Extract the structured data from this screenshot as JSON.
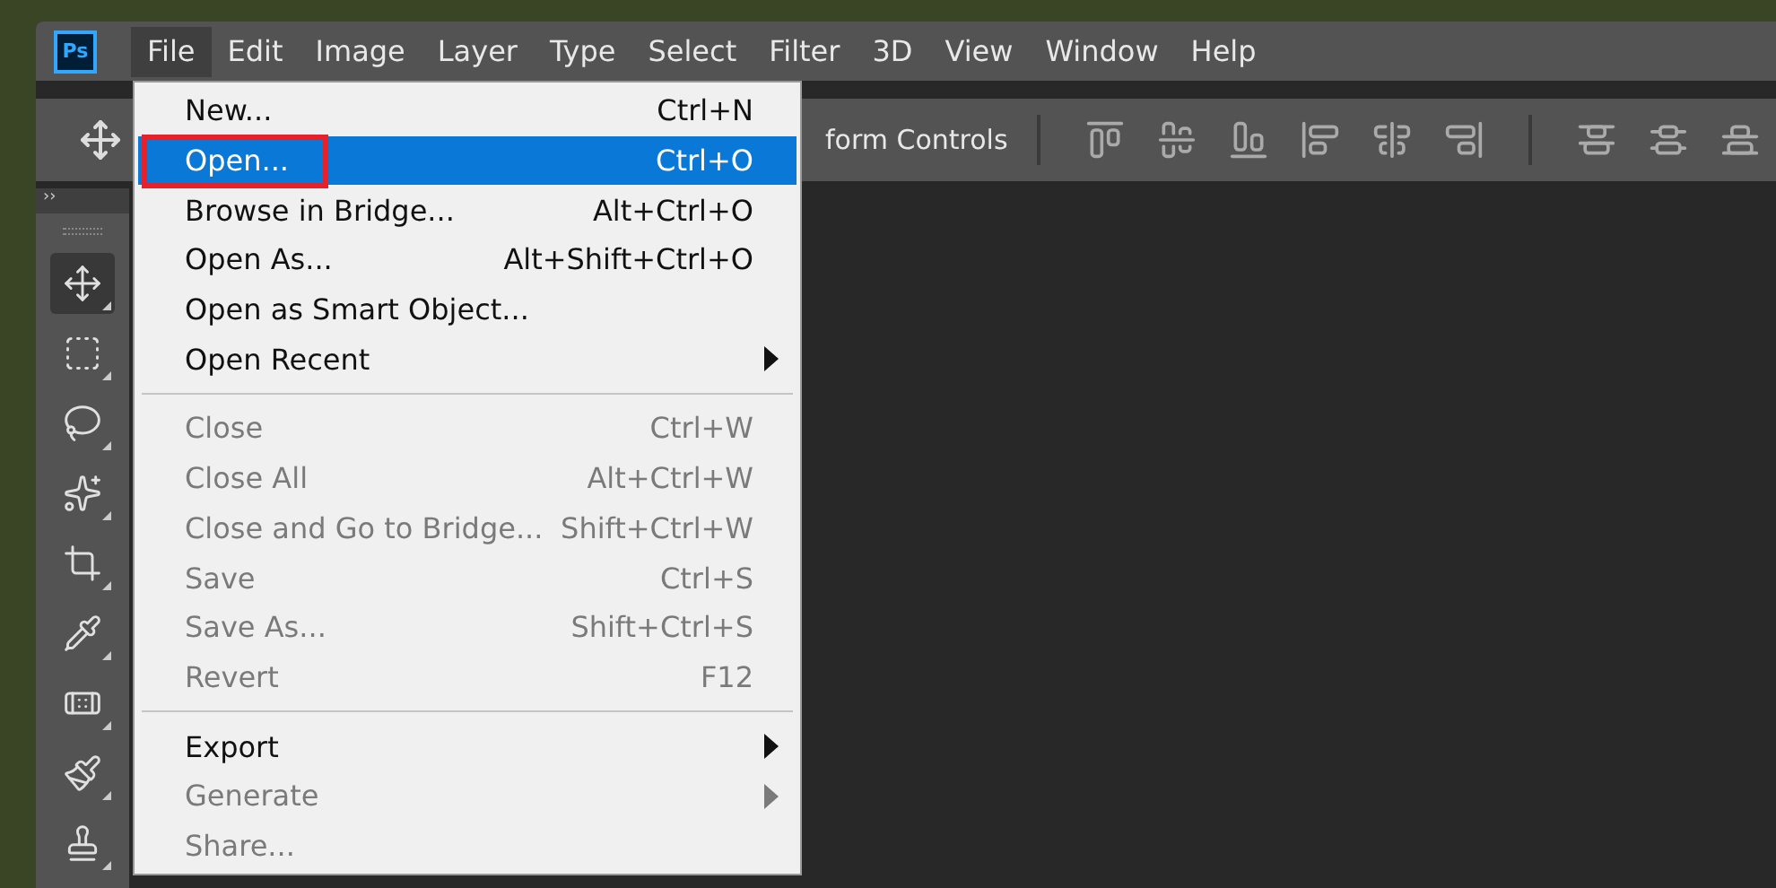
{
  "app_logo": "Ps",
  "menubar": [
    {
      "label": "File",
      "selected": true
    },
    {
      "label": "Edit",
      "selected": false
    },
    {
      "label": "Image",
      "selected": false
    },
    {
      "label": "Layer",
      "selected": false
    },
    {
      "label": "Type",
      "selected": false
    },
    {
      "label": "Select",
      "selected": false
    },
    {
      "label": "Filter",
      "selected": false
    },
    {
      "label": "3D",
      "selected": false
    },
    {
      "label": "View",
      "selected": false
    },
    {
      "label": "Window",
      "selected": false
    },
    {
      "label": "Help",
      "selected": false
    }
  ],
  "options_bar": {
    "label": "form Controls"
  },
  "panel_toggle": "››",
  "tools": [
    {
      "kind": "move",
      "selected": true
    },
    {
      "kind": "marquee",
      "selected": false
    },
    {
      "kind": "lasso",
      "selected": false
    },
    {
      "kind": "quick-select",
      "selected": false
    },
    {
      "kind": "crop",
      "selected": false
    },
    {
      "kind": "eyedropper",
      "selected": false
    },
    {
      "kind": "healing",
      "selected": false
    },
    {
      "kind": "brush",
      "selected": false
    },
    {
      "kind": "stamp",
      "selected": false
    }
  ],
  "file_menu": [
    {
      "kind": "item",
      "label": "New...",
      "shortcut": "Ctrl+N",
      "selected": false,
      "disabled": false,
      "annotated": false
    },
    {
      "kind": "item",
      "label": "Open...",
      "shortcut": "Ctrl+O",
      "selected": true,
      "disabled": false,
      "annotated": true
    },
    {
      "kind": "item",
      "label": "Browse in Bridge...",
      "shortcut": "Alt+Ctrl+O",
      "selected": false,
      "disabled": false,
      "annotated": false
    },
    {
      "kind": "item",
      "label": "Open As...",
      "shortcut": "Alt+Shift+Ctrl+O",
      "selected": false,
      "disabled": false,
      "annotated": false
    },
    {
      "kind": "item",
      "label": "Open as Smart Object...",
      "selected": false,
      "disabled": false,
      "annotated": false
    },
    {
      "kind": "submenu",
      "label": "Open Recent",
      "selected": false,
      "disabled": false,
      "annotated": false
    },
    {
      "kind": "separator"
    },
    {
      "kind": "item",
      "label": "Close",
      "shortcut": "Ctrl+W",
      "selected": false,
      "disabled": true,
      "annotated": false
    },
    {
      "kind": "item",
      "label": "Close All",
      "shortcut": "Alt+Ctrl+W",
      "selected": false,
      "disabled": true,
      "annotated": false
    },
    {
      "kind": "item",
      "label": "Close and Go to Bridge...",
      "shortcut": "Shift+Ctrl+W",
      "selected": false,
      "disabled": true,
      "annotated": false
    },
    {
      "kind": "item",
      "label": "Save",
      "shortcut": "Ctrl+S",
      "selected": false,
      "disabled": true,
      "annotated": false
    },
    {
      "kind": "item",
      "label": "Save As...",
      "shortcut": "Shift+Ctrl+S",
      "selected": false,
      "disabled": true,
      "annotated": false
    },
    {
      "kind": "item",
      "label": "Revert",
      "shortcut": "F12",
      "selected": false,
      "disabled": true,
      "annotated": false
    },
    {
      "kind": "separator"
    },
    {
      "kind": "submenu",
      "label": "Export",
      "selected": false,
      "disabled": false,
      "annotated": false
    },
    {
      "kind": "submenu",
      "label": "Generate",
      "selected": false,
      "disabled": true,
      "annotated": false
    },
    {
      "kind": "item",
      "label": "Share...",
      "selected": false,
      "disabled": true,
      "annotated": false
    }
  ]
}
